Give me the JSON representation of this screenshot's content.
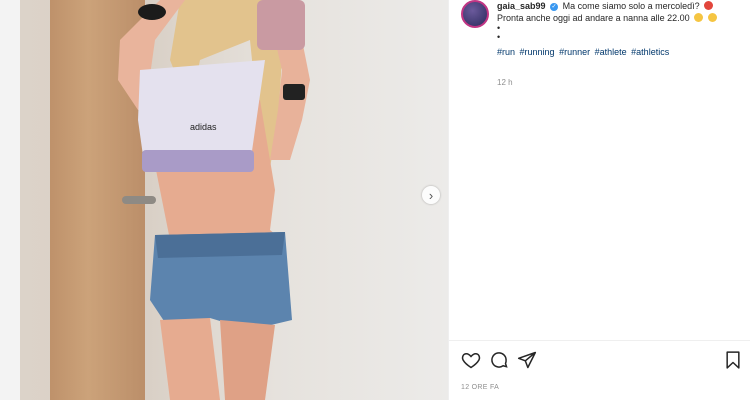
{
  "post": {
    "image_alt_icon": "photo",
    "next_icon": "chevron-right-icon",
    "next_symbol": "›"
  },
  "caption": {
    "username": "gaia_sab99",
    "line1": "Ma come siamo solo a mercoledì?",
    "line2": "Pronta anche oggi ad andare a nanna alle 22.00",
    "dot1": "•",
    "dot2": "•",
    "hashtags": [
      "#run",
      "#running",
      "#runner",
      "#athlete",
      "#athletics"
    ],
    "age": "12 h"
  },
  "actions": {
    "like": "heart-icon",
    "comment": "comment-icon",
    "share": "share-icon",
    "save": "bookmark-icon"
  },
  "footer": {
    "posted": "12 ORE FA"
  },
  "colors": {
    "link": "#00376b",
    "muted": "#8e8e8e",
    "text": "#262626",
    "verified": "#3897f0"
  }
}
